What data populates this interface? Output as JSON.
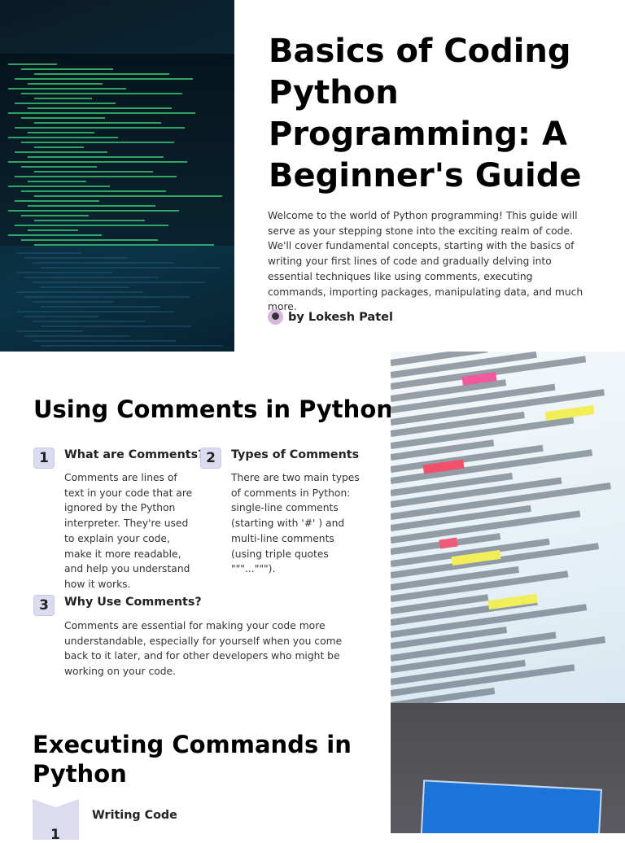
{
  "hero": {
    "title": "Basics of Coding Python Programming: A Beginner's Guide",
    "intro": "Welcome to the world of Python programming! This guide will serve as your stepping stone into the exciting realm of code. We'll cover fundamental concepts, starting with the basics of writing your first lines of code and gradually delving into essential techniques like using comments, executing commands, importing packages, manipulating data, and much more.",
    "author": "by Lokesh Patel"
  },
  "comments": {
    "heading": "Using Comments in Python",
    "items": [
      {
        "num": "1",
        "title": "What are Comments?",
        "body": "Comments are lines of text in your code that are ignored by the Python interpreter. They're used to explain your code, make it more readable, and help you understand how it works."
      },
      {
        "num": "2",
        "title": "Types of Comments",
        "body": "There are two main types of comments in Python: single-line comments (starting with '#' ) and multi-line comments (using triple quotes \"\"\"...\"\"\")."
      },
      {
        "num": "3",
        "title": "Why Use Comments?",
        "body": "Comments are essential for making your code more understandable, especially for yourself when you come back to it later, and for other developers who might be working on your code."
      }
    ]
  },
  "executing": {
    "heading": "Executing Commands in Python",
    "items": [
      {
        "num": "1",
        "title": "Writing Code"
      }
    ]
  }
}
